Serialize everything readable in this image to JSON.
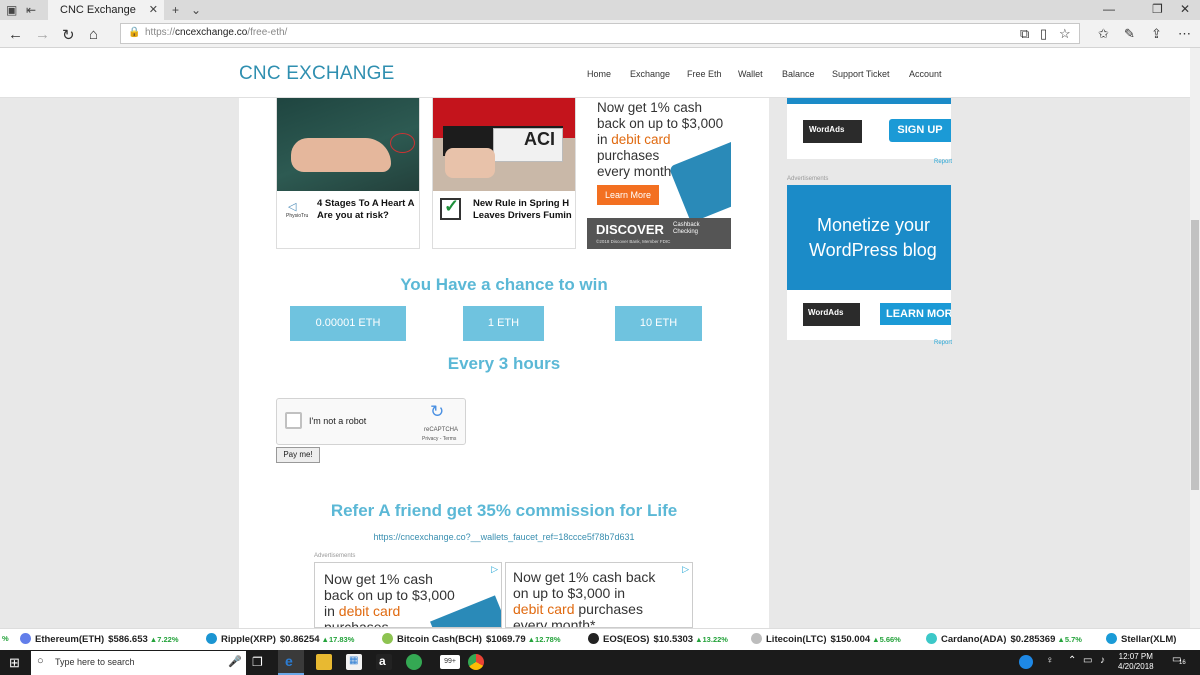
{
  "browser": {
    "tab_title": "CNC Exchange",
    "url_scheme": "https://",
    "url_host": "cncexchange.co",
    "url_path": "/free-eth/"
  },
  "site": {
    "logo": "CNC EXCHANGE",
    "nav": [
      "Home",
      "Exchange",
      "Free Eth",
      "Wallet",
      "Balance",
      "Support Ticket",
      "Account"
    ]
  },
  "ad_cards": [
    {
      "title_line1": "4 Stages To A Heart A",
      "title_line2": "Are you at risk?",
      "brand": "PhysioTru"
    },
    {
      "title_line1": "New Rule in Spring H",
      "title_line2": "Leaves Drivers Fumin"
    }
  ],
  "discover_ad": {
    "line1": "Now get 1% cash",
    "line2": "back on up to $3,000",
    "line3_prefix": "in ",
    "line3_highlight": "debit card",
    "line4": "purchases",
    "line5": "every month",
    "button": "Learn More",
    "brand": "DISCOVER",
    "brand_sub1": "Cashback",
    "brand_sub2": "Checking",
    "fine_print": "©2018 Discover Bank, Member FDIC"
  },
  "faucet": {
    "heading": "You Have a chance to win",
    "options": [
      "0.00001 ETH",
      "1 ETH",
      "10 ETH"
    ],
    "interval": "Every 3 hours",
    "captcha_label": "I'm not a robot",
    "captcha_brand": "reCAPTCHA",
    "captcha_links": "Privacy - Terms",
    "pay_button": "Pay me!"
  },
  "referral": {
    "heading": "Refer A friend get 35% commission for Life",
    "link": "https://cncexchange.co?__wallets_faucet_ref=18ccce5f78b7d631",
    "ads_label": "Advertisements"
  },
  "bottom_ads": [
    {
      "line1": "Now get 1% cash",
      "line2": "back on up to $3,000",
      "line3_prefix": "in ",
      "line3_highlight": "debit card",
      "line4": "purchases"
    },
    {
      "line1": "Now get 1% cash back",
      "line2": "on up to $3,000 in",
      "line3_highlight": "debit card",
      "line3_suffix": " purchases",
      "line4": "every month*"
    }
  ],
  "sidebar": {
    "wordads_1": "WordAds",
    "signup": "SIGN UP",
    "report": "Report",
    "ads_label": "Advertisements",
    "monetize_line1": "Monetize your",
    "monetize_line2": "WordPress blog",
    "wordads_2": "WordAds",
    "learn_more": "LEARN MORE"
  },
  "ticker": [
    {
      "name": "Ethereum(ETH)",
      "price": "$586.653",
      "change": "7.22%",
      "color": "#627eea"
    },
    {
      "name": "Ripple(XRP)",
      "price": "$0.86254",
      "change": "17.83%",
      "color": "#1b95d2"
    },
    {
      "name": "Bitcoin Cash(BCH)",
      "price": "$1069.79",
      "change": "12.78%",
      "color": "#8dc351"
    },
    {
      "name": "EOS(EOS)",
      "price": "$10.5303",
      "change": "13.22%",
      "color": "#222222"
    },
    {
      "name": "Litecoin(LTC)",
      "price": "$150.004",
      "change": "5.66%",
      "color": "#bdbdbd"
    },
    {
      "name": "Cardano(ADA)",
      "price": "$0.285369",
      "change": "5.7%",
      "color": "#3cc8c8"
    },
    {
      "name": "Stellar(XLM)",
      "price": "",
      "change": "",
      "color": "#1a9bd7"
    }
  ],
  "taskbar": {
    "search_placeholder": "Type here to search",
    "time": "12:07 PM",
    "date": "4/20/2018",
    "notif_count": "16"
  }
}
